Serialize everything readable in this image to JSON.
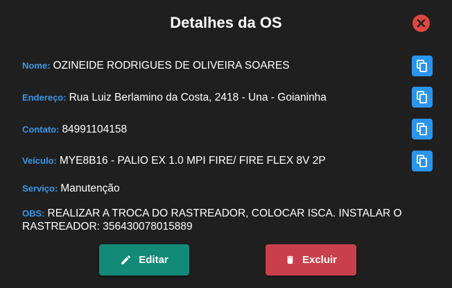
{
  "modal": {
    "title": "Detalhes da OS"
  },
  "fields": {
    "nome": {
      "label": "Nome:",
      "value": "OZINEIDE RODRIGUES DE OLIVEIRA SOARES"
    },
    "endereco": {
      "label": "Endereço:",
      "value": "Rua Luiz Berlamino da Costa, 2418 - Una - Goianinha"
    },
    "contato": {
      "label": "Contato:",
      "value": "84991104158"
    },
    "veiculo": {
      "label": "Veículo:",
      "value": "MYE8B16 - PALIO EX 1.0 MPI FIRE/ FIRE FLEX 8V 2P"
    },
    "servico": {
      "label": "Serviço:",
      "value": "Manutenção"
    },
    "obs": {
      "label": "OBS:",
      "value": "REALIZAR A TROCA DO RASTREADOR, COLOCAR ISCA. INSTALAR O RASTREADOR: 356430078015889"
    }
  },
  "buttons": {
    "edit_label": "Editar",
    "delete_label": "Excluir"
  },
  "icons": {
    "close": "close-icon",
    "copy": "copy-icon",
    "edit": "pencil-icon",
    "delete": "trash-icon"
  },
  "colors": {
    "background": "#1f1f1f",
    "label": "#3b97e8",
    "copy_button": "#2a95ee",
    "close_button": "#e0473e",
    "edit_button": "#138a78",
    "delete_button": "#c9404a"
  }
}
